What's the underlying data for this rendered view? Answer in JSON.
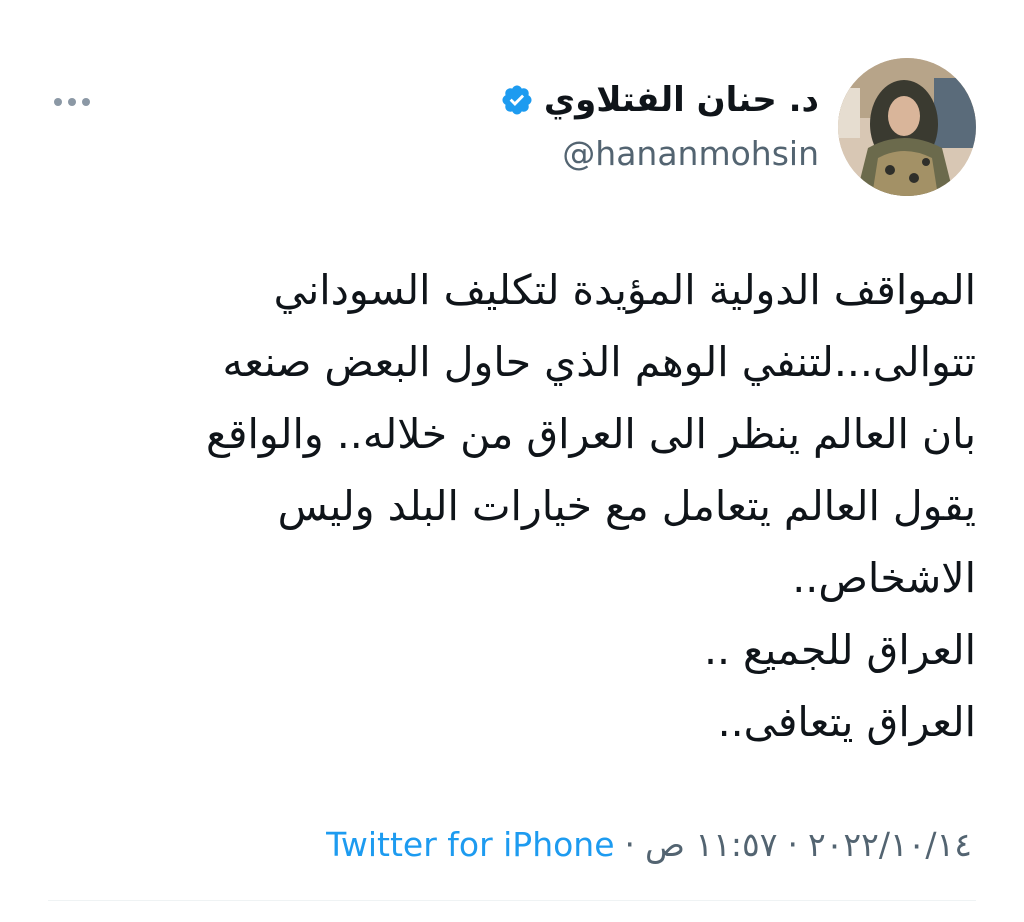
{
  "author": {
    "display_name": "د. حنان الفتلاوي",
    "handle": "@hananmohsin",
    "verified": true,
    "verified_icon": "verified-badge-icon",
    "avatar_icon": "avatar"
  },
  "tweet": {
    "text": "المواقف الدولية المؤيدة لتكليف السوداني\nتتوالى...لتنفي الوهم الذي حاول البعض صنعه\nبان العالم ينظر الى العراق من خلاله.. والواقع\nيقول العالم يتعامل مع خيارات البلد وليس\nالاشخاص..\nالعراق للجميع ..\nالعراق يتعافى.."
  },
  "meta": {
    "date": "٢٠٢٢/١٠/١٤",
    "time": "١١:٥٧ ص",
    "separator": "·",
    "source": "Twitter for iPhone"
  },
  "more_icon": "more-options-icon",
  "colors": {
    "text": "#0f1419",
    "secondary": "#536471",
    "link": "#1d9bf0",
    "divider": "#eff3f4"
  }
}
